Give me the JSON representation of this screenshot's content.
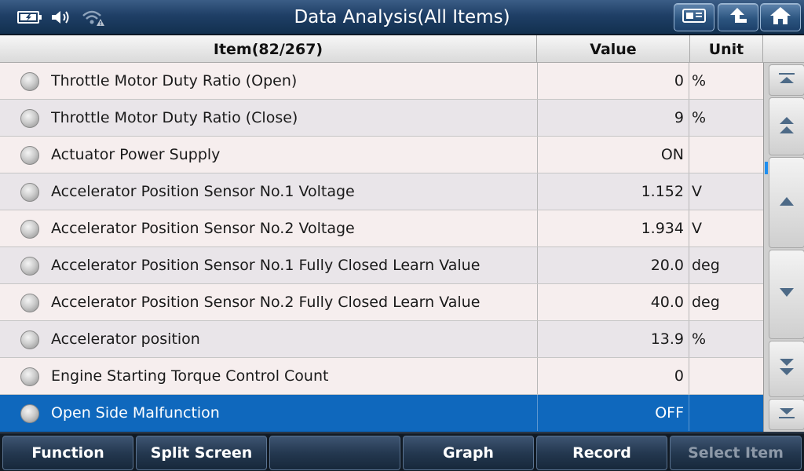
{
  "header": {
    "title": "Data Analysis(All Items)",
    "icons": [
      "battery-charging-icon",
      "speaker-icon",
      "wifi-warning-icon"
    ],
    "buttons": [
      "report-icon",
      "back-icon",
      "home-icon"
    ]
  },
  "table": {
    "headers": {
      "item": "Item(82/267)",
      "value": "Value",
      "unit": "Unit"
    },
    "rows": [
      {
        "name": "Throttle Motor Duty Ratio (Open)",
        "value": "0",
        "unit": "%"
      },
      {
        "name": "Throttle Motor Duty Ratio (Close)",
        "value": "9",
        "unit": "%"
      },
      {
        "name": "Actuator Power Supply",
        "value": "ON",
        "unit": ""
      },
      {
        "name": "Accelerator Position Sensor No.1 Voltage",
        "value": "1.152",
        "unit": "V"
      },
      {
        "name": "Accelerator Position Sensor No.2 Voltage",
        "value": "1.934",
        "unit": "V"
      },
      {
        "name": "Accelerator Position Sensor No.1 Fully Closed Learn Value",
        "value": "20.0",
        "unit": "deg"
      },
      {
        "name": "Accelerator Position Sensor No.2 Fully Closed Learn Value",
        "value": "40.0",
        "unit": "deg"
      },
      {
        "name": "Accelerator position",
        "value": "13.9",
        "unit": "%"
      },
      {
        "name": "Engine Starting Torque Control Count",
        "value": "0",
        "unit": ""
      },
      {
        "name": "Open Side Malfunction",
        "value": "OFF",
        "unit": "",
        "selected": true
      }
    ]
  },
  "toolbar": {
    "function": "Function",
    "split_screen": "Split Screen",
    "blank": "",
    "graph": "Graph",
    "record": "Record",
    "select_item": "Select Item"
  },
  "colors": {
    "selected_row": "#0f68bd",
    "titlebar": "#1f3f66",
    "accent": "#1e8ef0"
  }
}
